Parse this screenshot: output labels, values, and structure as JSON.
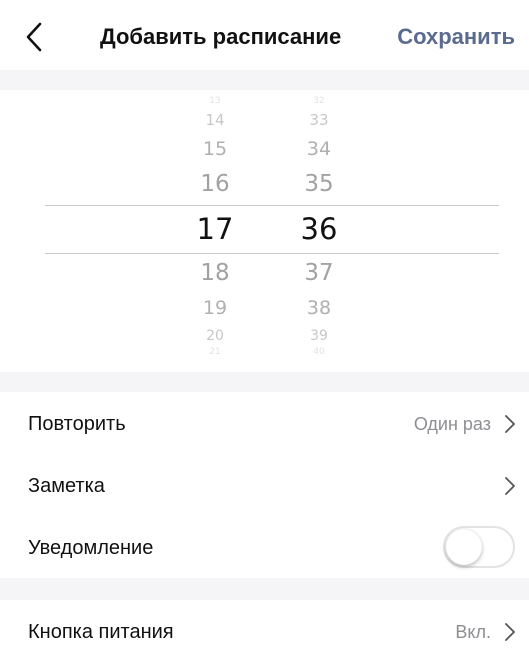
{
  "header": {
    "back_icon": "chevron-left-icon",
    "title": "Добавить расписание",
    "save_label": "Сохранить",
    "save_color": "#5b6a8f"
  },
  "time_picker": {
    "hours": [
      "13",
      "14",
      "15",
      "16",
      "17",
      "18",
      "19",
      "20",
      "21"
    ],
    "minutes": [
      "32",
      "33",
      "34",
      "35",
      "36",
      "37",
      "38",
      "39",
      "40"
    ],
    "selected_hour": "17",
    "selected_minute": "36"
  },
  "settings": {
    "repeat_label": "Повторить",
    "repeat_value": "Один раз",
    "note_label": "Заметка",
    "notification_label": "Уведомление",
    "notification_enabled": false,
    "power_button_label": "Кнопка питания",
    "power_button_value": "Вкл."
  }
}
